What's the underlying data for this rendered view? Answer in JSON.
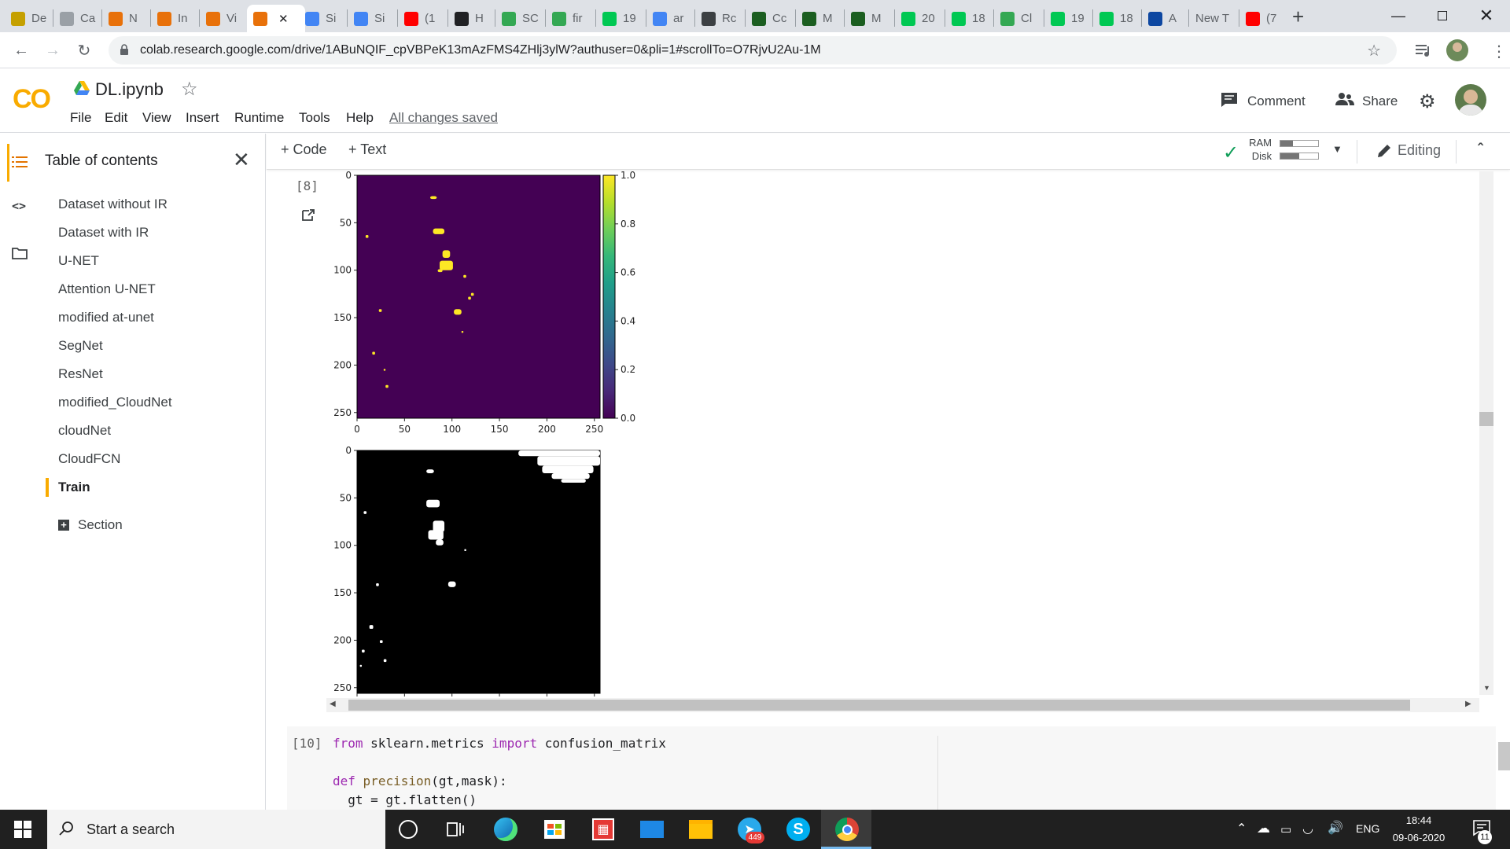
{
  "browser": {
    "tabs": [
      {
        "title": "De",
        "color": "#c5a000"
      },
      {
        "title": "Ca",
        "color": "#9aa0a6"
      },
      {
        "title": "N",
        "color": "#e8710a"
      },
      {
        "title": "In",
        "color": "#e8710a"
      },
      {
        "title": "Vi",
        "color": "#e8710a"
      },
      {
        "title": "",
        "color": "#e8710a"
      },
      {
        "title": "Si",
        "color": "#4285f4"
      },
      {
        "title": "Si",
        "color": "#4285f4"
      },
      {
        "title": "(1",
        "color": "#ff0000"
      },
      {
        "title": "H",
        "color": "#202124"
      },
      {
        "title": "SC",
        "color": "#34a853"
      },
      {
        "title": "fir",
        "color": "#34a853"
      },
      {
        "title": "19",
        "color": "#00c853"
      },
      {
        "title": "ar",
        "color": "#4285f4"
      },
      {
        "title": "Rc",
        "color": "#3c4043"
      },
      {
        "title": "Cc",
        "color": "#1b5e20"
      },
      {
        "title": "M",
        "color": "#1b5e20"
      },
      {
        "title": "M",
        "color": "#1b5e20"
      },
      {
        "title": "20",
        "color": "#00c853"
      },
      {
        "title": "18",
        "color": "#00c853"
      },
      {
        "title": "Cl",
        "color": "#34a853"
      },
      {
        "title": "19",
        "color": "#00c853"
      },
      {
        "title": "18",
        "color": "#00c853"
      },
      {
        "title": "A",
        "color": "#0d47a1"
      },
      {
        "title": "New T",
        "color": ""
      },
      {
        "title": "(7",
        "color": "#ff0000"
      }
    ],
    "url": "colab.research.google.com/drive/1ABuNQIF_cpVBPeK13mAzFMS4ZHlj3ylW?authuser=0&pli=1#scrollTo=O7RjvU2Au-1M"
  },
  "colab": {
    "logo": "CO",
    "notebook_title": "DL.ipynb",
    "menu": [
      "File",
      "Edit",
      "View",
      "Insert",
      "Runtime",
      "Tools",
      "Help"
    ],
    "save_status": "All changes saved",
    "comment_label": "Comment",
    "share_label": "Share"
  },
  "sidebar": {
    "title": "Table of contents",
    "items": [
      "Dataset without IR",
      "Dataset with IR",
      "U-NET",
      "Attention U-NET",
      "modified at-unet",
      "SegNet",
      "ResNet",
      "modified_CloudNet",
      "cloudNet",
      "CloudFCN",
      "Train"
    ],
    "active": "Train",
    "section_label": "Section"
  },
  "nb_toolbar": {
    "code_label": "Code",
    "text_label": "Text",
    "ram_label": "RAM",
    "disk_label": "Disk",
    "editing_label": "Editing"
  },
  "cell8": {
    "exec_count": "[8]"
  },
  "chart_data": [
    {
      "type": "heatmap",
      "colormap": "viridis",
      "xlim": [
        0,
        256
      ],
      "ylim": [
        256,
        0
      ],
      "xticks": [
        0,
        50,
        100,
        150,
        200,
        250
      ],
      "yticks": [
        0,
        50,
        100,
        150,
        200,
        250
      ],
      "colorbar": {
        "min": 0.0,
        "max": 1.0,
        "ticks": [
          "0.0",
          "0.2",
          "0.4",
          "0.6",
          "0.8",
          "1.0"
        ]
      },
      "blobs": [
        {
          "x": 77,
          "y": 22,
          "w": 7,
          "h": 3
        },
        {
          "x": 80,
          "y": 56,
          "w": 12,
          "h": 6
        },
        {
          "x": 90,
          "y": 79,
          "w": 8,
          "h": 8
        },
        {
          "x": 87,
          "y": 90,
          "w": 14,
          "h": 10
        },
        {
          "x": 85,
          "y": 99,
          "w": 5,
          "h": 3
        },
        {
          "x": 102,
          "y": 141,
          "w": 8,
          "h": 6
        },
        {
          "x": 9,
          "y": 63,
          "w": 3,
          "h": 3
        },
        {
          "x": 23,
          "y": 141,
          "w": 3,
          "h": 3
        },
        {
          "x": 16,
          "y": 186,
          "w": 3,
          "h": 3
        },
        {
          "x": 30,
          "y": 221,
          "w": 3,
          "h": 3
        },
        {
          "x": 112,
          "y": 105,
          "w": 3,
          "h": 3
        },
        {
          "x": 117,
          "y": 128,
          "w": 3,
          "h": 3
        },
        {
          "x": 120,
          "y": 124,
          "w": 3,
          "h": 3
        },
        {
          "x": 110,
          "y": 164,
          "w": 2,
          "h": 2
        },
        {
          "x": 28,
          "y": 204,
          "w": 2,
          "h": 2
        }
      ]
    },
    {
      "type": "heatmap",
      "colormap": "gray",
      "xlim": [
        0,
        256
      ],
      "ylim": [
        256,
        0
      ],
      "yticks": [
        0,
        50,
        100,
        150,
        200,
        250
      ],
      "blobs": [
        {
          "x": 73,
          "y": 20,
          "w": 8,
          "h": 4
        },
        {
          "x": 73,
          "y": 52,
          "w": 14,
          "h": 8
        },
        {
          "x": 80,
          "y": 74,
          "w": 12,
          "h": 12
        },
        {
          "x": 75,
          "y": 84,
          "w": 16,
          "h": 10
        },
        {
          "x": 83,
          "y": 94,
          "w": 8,
          "h": 6
        },
        {
          "x": 96,
          "y": 138,
          "w": 8,
          "h": 6
        },
        {
          "x": 20,
          "y": 140,
          "w": 3,
          "h": 3
        },
        {
          "x": 7,
          "y": 64,
          "w": 3,
          "h": 3
        },
        {
          "x": 13,
          "y": 184,
          "w": 4,
          "h": 4
        },
        {
          "x": 24,
          "y": 200,
          "w": 3,
          "h": 3
        },
        {
          "x": 28,
          "y": 220,
          "w": 3,
          "h": 3
        },
        {
          "x": 5,
          "y": 210,
          "w": 3,
          "h": 3
        },
        {
          "x": 3,
          "y": 226,
          "w": 2,
          "h": 2
        },
        {
          "x": 113,
          "y": 104,
          "w": 2,
          "h": 2
        },
        {
          "x": 170,
          "y": 0,
          "w": 86,
          "h": 6
        },
        {
          "x": 190,
          "y": 6,
          "w": 66,
          "h": 10
        },
        {
          "x": 195,
          "y": 16,
          "w": 54,
          "h": 8
        },
        {
          "x": 205,
          "y": 24,
          "w": 40,
          "h": 6
        },
        {
          "x": 215,
          "y": 30,
          "w": 26,
          "h": 4
        }
      ]
    }
  ],
  "cell10": {
    "exec_count": "[10]",
    "lines": [
      [
        {
          "t": "from",
          "c": "kw"
        },
        {
          "t": " sklearn.metrics ",
          "c": ""
        },
        {
          "t": "import",
          "c": "kw"
        },
        {
          "t": " confusion_matrix",
          "c": ""
        }
      ],
      [],
      [
        {
          "t": "def",
          "c": "kw"
        },
        {
          "t": " ",
          "c": ""
        },
        {
          "t": "precision",
          "c": "fn"
        },
        {
          "t": "(gt,mask):",
          "c": ""
        }
      ],
      [
        {
          "t": "  gt = gt.flatten()",
          "c": ""
        }
      ]
    ]
  },
  "taskbar": {
    "search_placeholder": "Start a search",
    "telegram_badge": "449",
    "language": "ENG",
    "time": "18:44",
    "date": "09-06-2020",
    "notification_count": "11"
  }
}
